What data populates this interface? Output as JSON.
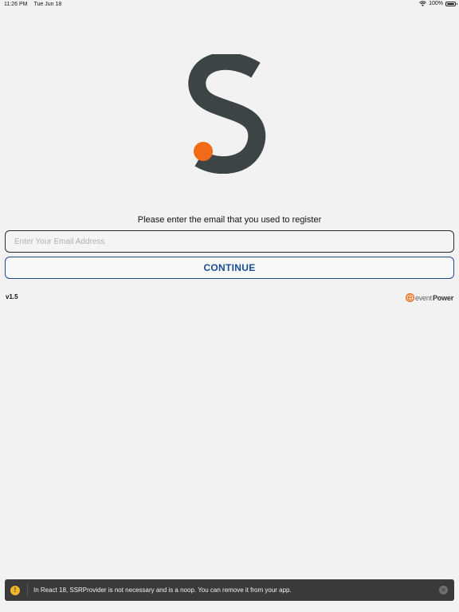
{
  "status_bar": {
    "time": "11:26 PM",
    "date": "Tue Jun 18",
    "battery_percent": "100%",
    "battery_level": 1.0
  },
  "logo": {
    "icon": "s-logo-icon",
    "letter_color": "#3c4446",
    "dot_color": "#f26a18"
  },
  "login": {
    "prompt": "Please enter the email that you used to register",
    "email_placeholder": "Enter Your Email Address",
    "email_value": "",
    "continue_label": "CONTINUE"
  },
  "footer": {
    "version": "v1.5",
    "brand_event": "event",
    "brand_power": "Power",
    "brand_icon": "eventpower-logo-icon"
  },
  "warning": {
    "icon": "warning-icon",
    "message": "In React 18, SSRProvider is not necessary and is a noop. You can remove it from your app.",
    "dismiss_icon": "close-icon"
  },
  "colors": {
    "accent": "#1a4f95",
    "orange": "#f26a18",
    "background": "#f2f2f2",
    "warning_bg": "#3a3a3a"
  }
}
